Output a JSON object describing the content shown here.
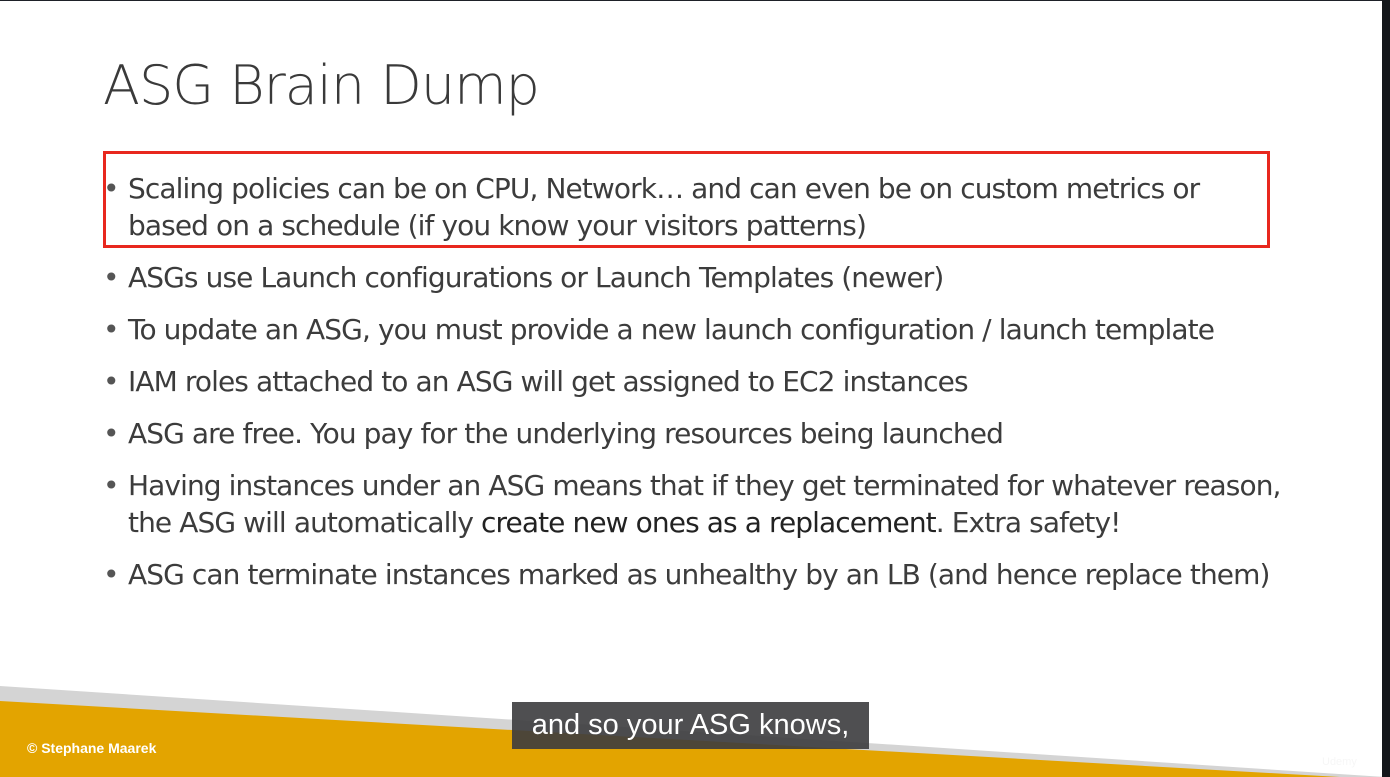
{
  "slide": {
    "title": "ASG Brain Dump",
    "bullets": [
      {
        "lines": [
          "Scaling policies can be on CPU, Network… and can even be on custom metrics or",
          "based on a schedule (if you know your visitors patterns)"
        ]
      },
      {
        "text": "ASGs use Launch configurations or Launch Templates (newer)"
      },
      {
        "text": "To update an ASG, you must provide a new launch configuration / launch template"
      },
      {
        "text": "IAM roles attached to an ASG will get assigned to EC2 instances"
      },
      {
        "text": "ASG are free. You pay for the underlying resources being launched"
      },
      {
        "line1": "Having instances under an ASG means that if they get terminated for whatever reason,",
        "line2_pre": "the ASG will automatically ",
        "line2_bold": "create new ones as a replacement",
        "line2_post": ". Extra safety!"
      },
      {
        "text": "ASG can terminate instances marked as unhealthy by an LB (and hence replace them)"
      }
    ],
    "copyright": "© Stephane Maarek"
  },
  "player": {
    "caption": "and so your ASG knows,",
    "watermark": "Udemy"
  },
  "colors": {
    "highlight": "#e8281e",
    "footer": "#e3a400",
    "band": "#d4d4d4"
  }
}
